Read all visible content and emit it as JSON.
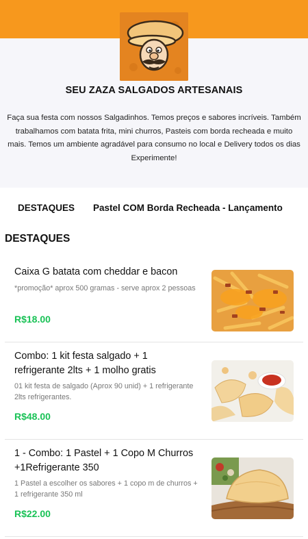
{
  "header": {
    "store_name": "SEU ZAZA SALGADOS ARTESANAIS",
    "description": "Faça sua festa com nossos Salgadinhos. Temos preços e sabores incríveis. Também trabalhamos com batata frita, mini churros, Pasteis com borda recheada e muito mais. Temos um ambiente agradável para consumo no local e Delivery todos os dias Experimente!"
  },
  "tabs": [
    {
      "label": "DESTAQUES"
    },
    {
      "label": "Pastel COM Borda Recheada - Lançamento"
    }
  ],
  "section": {
    "title": "DESTAQUES"
  },
  "products": [
    {
      "name": "Caixa G batata com cheddar e bacon",
      "description": "*promoção* aprox 500 gramas - serve aprox 2 pessoas",
      "price": "R$18.00",
      "image_icon": "fries-cheddar-bacon-photo"
    },
    {
      "name": "Combo: 1 kit festa salgado + 1 refrigerante 2lts + 1 molho gratis",
      "description": "01 kit festa de salgado (Aprox 90 unid) + 1 refrigerante 2lts refrigerantes.",
      "price": "R$48.00",
      "image_icon": "fried-snacks-photo"
    },
    {
      "name": "1 - Combo: 1 Pastel + 1 Copo M Churros +1Refrigerante 350",
      "description": "1 Pastel a escolher os sabores + 1 copo m de churros + 1 refrigerante 350 ml",
      "price": "R$22.00",
      "image_icon": "pastel-photo"
    }
  ],
  "colors": {
    "brand_orange": "#f7981d",
    "price_green": "#19c256",
    "header_bg": "#f6f6fa"
  }
}
